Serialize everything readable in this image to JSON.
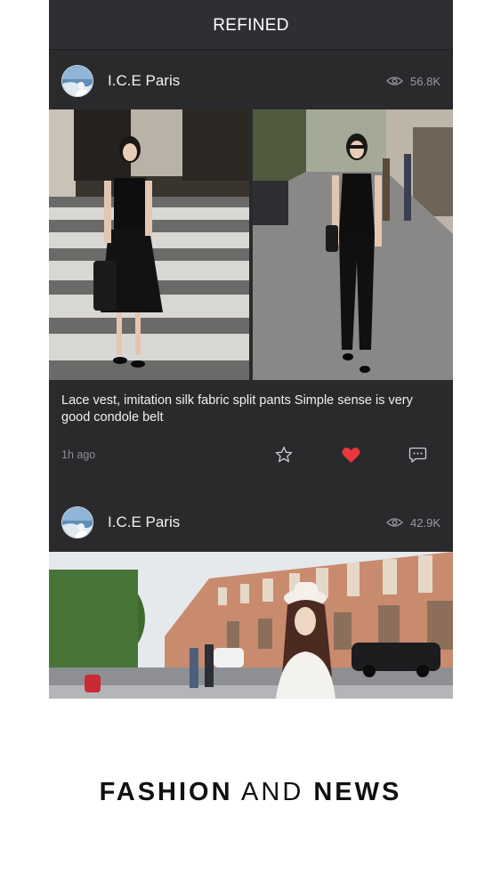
{
  "header": {
    "title": "REFINED"
  },
  "posts": [
    {
      "author": "I.C.E Paris",
      "views": "56.8K",
      "caption": "Lace vest, imitation silk fabric split pants Simple sense is very good condole belt",
      "time": "1h ago",
      "liked": true
    },
    {
      "author": "I.C.E Paris",
      "views": "42.9K"
    }
  ],
  "tagline": {
    "part1": "FASHION",
    "part2": "AND",
    "part3": "NEWS"
  },
  "colors": {
    "background": "#2a2a2d",
    "heart": "#e8383d",
    "text": "#f1f1f1",
    "muted": "#8d8d93"
  },
  "icons": [
    "eye-icon",
    "star-icon",
    "heart-icon",
    "comment-icon"
  ]
}
